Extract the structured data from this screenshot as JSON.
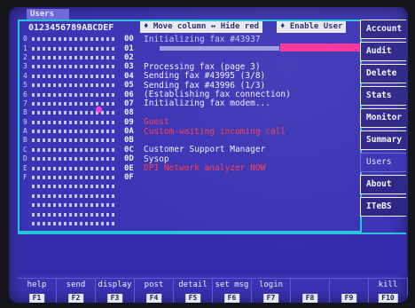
{
  "window": {
    "title": "Users"
  },
  "hex_header": "0123456789ABCDEF",
  "grid_rows": [
    "0",
    "1",
    "2",
    "3",
    "4",
    "5",
    "6",
    "7",
    "8",
    "9",
    "A",
    "B",
    "C",
    "D",
    "E",
    "F",
    "",
    "",
    "",
    "",
    ""
  ],
  "toolbar": {
    "move_column": "♦ Move column ↔ Hide red",
    "enable_user": "♦ Enable User"
  },
  "lines": [
    {
      "num": "00",
      "text": "Initializing fax #43937",
      "style": "dim"
    },
    {
      "num": "01",
      "text": "",
      "style": ""
    },
    {
      "num": "02",
      "text": "",
      "style": ""
    },
    {
      "num": "03",
      "text": "Processing fax (page 3)",
      "style": ""
    },
    {
      "num": "04",
      "text": "Sending fax #43995 (3/8)",
      "style": ""
    },
    {
      "num": "05",
      "text": "Sending fax #43996 (1/3)",
      "style": ""
    },
    {
      "num": "06",
      "text": "(Establishing fax connection)",
      "style": ""
    },
    {
      "num": "07",
      "text": "Initializing fax modem...",
      "style": ""
    },
    {
      "num": "08",
      "text": "",
      "style": ""
    },
    {
      "num": "09",
      "text": "Guest",
      "style": "red"
    },
    {
      "num": "0A",
      "text": "Custom-waiting incoming call",
      "style": "red"
    },
    {
      "num": "0B",
      "text": "",
      "style": ""
    },
    {
      "num": "0C",
      "text": "Customer Support Manager",
      "style": ""
    },
    {
      "num": "0D",
      "text": "Sysop",
      "style": ""
    },
    {
      "num": "0E",
      "text": "DPI Network analyzer NOW",
      "style": "red"
    },
    {
      "num": "0F",
      "text": "",
      "style": ""
    }
  ],
  "sidebar": [
    {
      "label": "Account",
      "active": false
    },
    {
      "label": "Audit",
      "active": false
    },
    {
      "label": "Delete",
      "active": false
    },
    {
      "label": "Stats",
      "active": false
    },
    {
      "label": "Monitor",
      "active": false
    },
    {
      "label": "Summary",
      "active": false
    },
    {
      "label": "Users",
      "active": true
    },
    {
      "label": "About",
      "active": false
    },
    {
      "label": "ITeBS",
      "active": false
    }
  ],
  "fkeys": [
    {
      "label": "help",
      "key": "F1"
    },
    {
      "label": "send",
      "key": "F2"
    },
    {
      "label": "display",
      "key": "F3"
    },
    {
      "label": "post",
      "key": "F4"
    },
    {
      "label": "detail",
      "key": "F5"
    },
    {
      "label": "set msg",
      "key": "F6"
    },
    {
      "label": "login",
      "key": "F7"
    },
    {
      "label": "",
      "key": "F8"
    },
    {
      "label": "",
      "key": "F9"
    },
    {
      "label": "kill",
      "key": "F10"
    }
  ],
  "colors": {
    "screen": "#3a33b4",
    "frame": "#26c5d6",
    "highlight": "#ff2f9a",
    "alert": "#ff3a4a"
  }
}
